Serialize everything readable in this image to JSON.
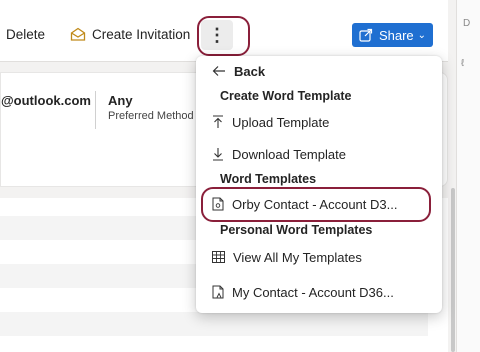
{
  "toolbar": {
    "delete_label": "Delete",
    "create_invitation_label": "Create Invitation",
    "more_label": "⋮",
    "share_label": "Share"
  },
  "contact": {
    "email": "@outlook.com",
    "preferred_value": "Any",
    "preferred_label": "Preferred Method o"
  },
  "menu": {
    "back": "Back",
    "create_word_template": "Create Word Template",
    "upload_template": "Upload Template",
    "download_template": "Download Template",
    "word_templates": "Word Templates",
    "orby_contact": "Orby Contact - Account D3...",
    "personal_word_templates": "Personal Word Templates",
    "view_all": "View All My Templates",
    "my_contact": "My Contact - Account D36..."
  },
  "rightbar": {
    "mark_top": "D",
    "mark_2": "ℓ"
  },
  "colors": {
    "accent": "#1f6fd1",
    "highlight": "#8a1f3a"
  }
}
